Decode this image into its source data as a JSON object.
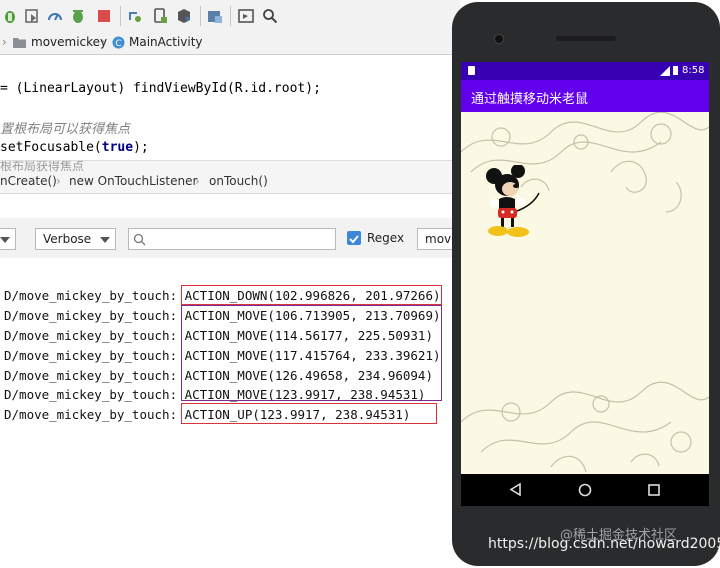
{
  "ide": {
    "navbar": {
      "project": "movemickey",
      "file": "MainActivity"
    },
    "code": {
      "line1": "= (LinearLayout) findViewById(R.id.root);",
      "comment": "置根布局可以获得焦点",
      "line3_pre": "setFocusable(",
      "line3_kw": "true",
      "line3_post": ");",
      "ghost": "根布局获得焦点"
    },
    "structure_breadcrumb": [
      "nCreate()",
      "new OnTouchListener",
      "onTouch()"
    ],
    "logcat": {
      "level": "Verbose",
      "search_placeholder": "Q·",
      "regex_label": "Regex",
      "regex_checked": true,
      "package_filter": "move"
    },
    "log_lines": [
      {
        "tag": "D/move_mickey_by_touch:",
        "msg": "ACTION_DOWN(102.996826, 201.97266)"
      },
      {
        "tag": "D/move_mickey_by_touch:",
        "msg": "ACTION_MOVE(106.713905, 213.70969)"
      },
      {
        "tag": "D/move_mickey_by_touch:",
        "msg": "ACTION_MOVE(114.56177, 225.50931)"
      },
      {
        "tag": "D/move_mickey_by_touch:",
        "msg": "ACTION_MOVE(117.415764, 233.39621)"
      },
      {
        "tag": "D/move_mickey_by_touch:",
        "msg": "ACTION_MOVE(126.49658, 234.96094)"
      },
      {
        "tag": "D/move_mickey_by_touch:",
        "msg": "ACTION_MOVE(123.9917, 238.94531)"
      },
      {
        "tag": "D/move_mickey_by_touch:",
        "msg": "ACTION_UP(123.9917, 238.94531)"
      }
    ],
    "highlight_colors": {
      "down_up": "#d9343b",
      "move": "#7a2f8e"
    }
  },
  "phone": {
    "status_time": "8:58",
    "app_title": "通过触摸移动米老鼠",
    "colors": {
      "appbar": "#6200ee",
      "statusbar": "#3700b3",
      "background": "#fbf8e4"
    }
  },
  "watermark": "https://blog.csdn.net/howard2005",
  "watermark_overlay": "@稀土掘金技术社区"
}
